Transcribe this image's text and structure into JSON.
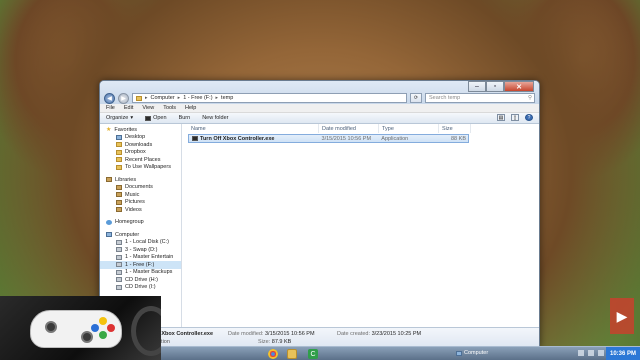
{
  "window": {
    "address_parts": [
      "Computer",
      "1 - Free (F:)",
      "temp"
    ],
    "search_placeholder": "Search temp"
  },
  "menu": [
    "File",
    "Edit",
    "View",
    "Tools",
    "Help"
  ],
  "commands": {
    "organize": "Organize",
    "open": "Open",
    "burn": "Burn",
    "new_folder": "New folder"
  },
  "sidebar": {
    "favorites": {
      "label": "Favorites",
      "items": [
        "Desktop",
        "Downloads",
        "Dropbox",
        "Recent Places",
        "To Use Wallpapers"
      ]
    },
    "libraries": {
      "label": "Libraries",
      "items": [
        "Documents",
        "Music",
        "Pictures",
        "Videos"
      ]
    },
    "homegroup": "Homegroup",
    "computer": {
      "label": "Computer",
      "items": [
        "1 - Local Disk (C:)",
        "3 - Swap (D:)",
        "1 - Master Entertain",
        "1 - Free (F:)",
        "1 - Master Backups",
        "CD Drive (H:)",
        "CD Drive (I:)"
      ],
      "selected_index": 3
    }
  },
  "columns": {
    "name": "Name",
    "date": "Date modified",
    "type": "Type",
    "size": "Size"
  },
  "files": [
    {
      "name": "Turn Off Xbox Controller.exe",
      "date": "3/15/2015 10:56 PM",
      "type": "Application",
      "size": "88 KB"
    }
  ],
  "details": {
    "name": "f Xbox Controller.exe",
    "type": "ation",
    "modified_label": "Date modified:",
    "modified": "3/15/2015 10:56 PM",
    "size_label": "Size:",
    "size": "87.9 KB",
    "created_label": "Date created:",
    "created": "3/23/2015 10:25 PM"
  },
  "taskbar": {
    "computer_label": "Computer",
    "clock": "10:36 PM"
  },
  "colors": {
    "selection": "#cfe2f6",
    "taskbar": "#5b7089",
    "clock_bg": "#2c78d6"
  }
}
